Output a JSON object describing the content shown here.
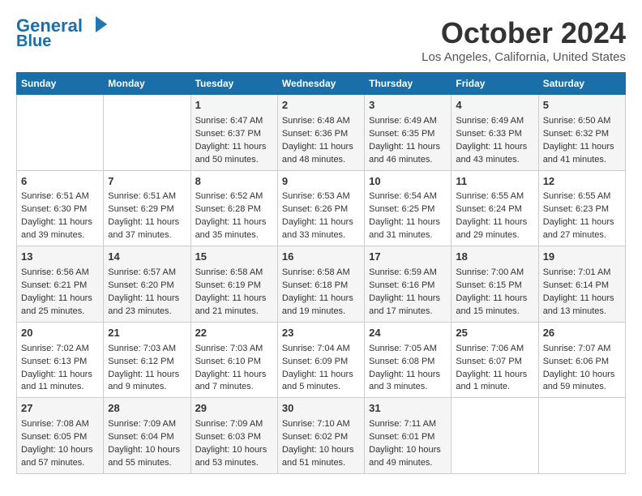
{
  "header": {
    "logo_line1": "General",
    "logo_line2": "Blue",
    "month": "October 2024",
    "location": "Los Angeles, California, United States"
  },
  "days_of_week": [
    "Sunday",
    "Monday",
    "Tuesday",
    "Wednesday",
    "Thursday",
    "Friday",
    "Saturday"
  ],
  "weeks": [
    [
      {
        "day": "",
        "sunrise": "",
        "sunset": "",
        "daylight": ""
      },
      {
        "day": "",
        "sunrise": "",
        "sunset": "",
        "daylight": ""
      },
      {
        "day": "1",
        "sunrise": "Sunrise: 6:47 AM",
        "sunset": "Sunset: 6:37 PM",
        "daylight": "Daylight: 11 hours and 50 minutes."
      },
      {
        "day": "2",
        "sunrise": "Sunrise: 6:48 AM",
        "sunset": "Sunset: 6:36 PM",
        "daylight": "Daylight: 11 hours and 48 minutes."
      },
      {
        "day": "3",
        "sunrise": "Sunrise: 6:49 AM",
        "sunset": "Sunset: 6:35 PM",
        "daylight": "Daylight: 11 hours and 46 minutes."
      },
      {
        "day": "4",
        "sunrise": "Sunrise: 6:49 AM",
        "sunset": "Sunset: 6:33 PM",
        "daylight": "Daylight: 11 hours and 43 minutes."
      },
      {
        "day": "5",
        "sunrise": "Sunrise: 6:50 AM",
        "sunset": "Sunset: 6:32 PM",
        "daylight": "Daylight: 11 hours and 41 minutes."
      }
    ],
    [
      {
        "day": "6",
        "sunrise": "Sunrise: 6:51 AM",
        "sunset": "Sunset: 6:30 PM",
        "daylight": "Daylight: 11 hours and 39 minutes."
      },
      {
        "day": "7",
        "sunrise": "Sunrise: 6:51 AM",
        "sunset": "Sunset: 6:29 PM",
        "daylight": "Daylight: 11 hours and 37 minutes."
      },
      {
        "day": "8",
        "sunrise": "Sunrise: 6:52 AM",
        "sunset": "Sunset: 6:28 PM",
        "daylight": "Daylight: 11 hours and 35 minutes."
      },
      {
        "day": "9",
        "sunrise": "Sunrise: 6:53 AM",
        "sunset": "Sunset: 6:26 PM",
        "daylight": "Daylight: 11 hours and 33 minutes."
      },
      {
        "day": "10",
        "sunrise": "Sunrise: 6:54 AM",
        "sunset": "Sunset: 6:25 PM",
        "daylight": "Daylight: 11 hours and 31 minutes."
      },
      {
        "day": "11",
        "sunrise": "Sunrise: 6:55 AM",
        "sunset": "Sunset: 6:24 PM",
        "daylight": "Daylight: 11 hours and 29 minutes."
      },
      {
        "day": "12",
        "sunrise": "Sunrise: 6:55 AM",
        "sunset": "Sunset: 6:23 PM",
        "daylight": "Daylight: 11 hours and 27 minutes."
      }
    ],
    [
      {
        "day": "13",
        "sunrise": "Sunrise: 6:56 AM",
        "sunset": "Sunset: 6:21 PM",
        "daylight": "Daylight: 11 hours and 25 minutes."
      },
      {
        "day": "14",
        "sunrise": "Sunrise: 6:57 AM",
        "sunset": "Sunset: 6:20 PM",
        "daylight": "Daylight: 11 hours and 23 minutes."
      },
      {
        "day": "15",
        "sunrise": "Sunrise: 6:58 AM",
        "sunset": "Sunset: 6:19 PM",
        "daylight": "Daylight: 11 hours and 21 minutes."
      },
      {
        "day": "16",
        "sunrise": "Sunrise: 6:58 AM",
        "sunset": "Sunset: 6:18 PM",
        "daylight": "Daylight: 11 hours and 19 minutes."
      },
      {
        "day": "17",
        "sunrise": "Sunrise: 6:59 AM",
        "sunset": "Sunset: 6:16 PM",
        "daylight": "Daylight: 11 hours and 17 minutes."
      },
      {
        "day": "18",
        "sunrise": "Sunrise: 7:00 AM",
        "sunset": "Sunset: 6:15 PM",
        "daylight": "Daylight: 11 hours and 15 minutes."
      },
      {
        "day": "19",
        "sunrise": "Sunrise: 7:01 AM",
        "sunset": "Sunset: 6:14 PM",
        "daylight": "Daylight: 11 hours and 13 minutes."
      }
    ],
    [
      {
        "day": "20",
        "sunrise": "Sunrise: 7:02 AM",
        "sunset": "Sunset: 6:13 PM",
        "daylight": "Daylight: 11 hours and 11 minutes."
      },
      {
        "day": "21",
        "sunrise": "Sunrise: 7:03 AM",
        "sunset": "Sunset: 6:12 PM",
        "daylight": "Daylight: 11 hours and 9 minutes."
      },
      {
        "day": "22",
        "sunrise": "Sunrise: 7:03 AM",
        "sunset": "Sunset: 6:10 PM",
        "daylight": "Daylight: 11 hours and 7 minutes."
      },
      {
        "day": "23",
        "sunrise": "Sunrise: 7:04 AM",
        "sunset": "Sunset: 6:09 PM",
        "daylight": "Daylight: 11 hours and 5 minutes."
      },
      {
        "day": "24",
        "sunrise": "Sunrise: 7:05 AM",
        "sunset": "Sunset: 6:08 PM",
        "daylight": "Daylight: 11 hours and 3 minutes."
      },
      {
        "day": "25",
        "sunrise": "Sunrise: 7:06 AM",
        "sunset": "Sunset: 6:07 PM",
        "daylight": "Daylight: 11 hours and 1 minute."
      },
      {
        "day": "26",
        "sunrise": "Sunrise: 7:07 AM",
        "sunset": "Sunset: 6:06 PM",
        "daylight": "Daylight: 10 hours and 59 minutes."
      }
    ],
    [
      {
        "day": "27",
        "sunrise": "Sunrise: 7:08 AM",
        "sunset": "Sunset: 6:05 PM",
        "daylight": "Daylight: 10 hours and 57 minutes."
      },
      {
        "day": "28",
        "sunrise": "Sunrise: 7:09 AM",
        "sunset": "Sunset: 6:04 PM",
        "daylight": "Daylight: 10 hours and 55 minutes."
      },
      {
        "day": "29",
        "sunrise": "Sunrise: 7:09 AM",
        "sunset": "Sunset: 6:03 PM",
        "daylight": "Daylight: 10 hours and 53 minutes."
      },
      {
        "day": "30",
        "sunrise": "Sunrise: 7:10 AM",
        "sunset": "Sunset: 6:02 PM",
        "daylight": "Daylight: 10 hours and 51 minutes."
      },
      {
        "day": "31",
        "sunrise": "Sunrise: 7:11 AM",
        "sunset": "Sunset: 6:01 PM",
        "daylight": "Daylight: 10 hours and 49 minutes."
      },
      {
        "day": "",
        "sunrise": "",
        "sunset": "",
        "daylight": ""
      },
      {
        "day": "",
        "sunrise": "",
        "sunset": "",
        "daylight": ""
      }
    ]
  ]
}
